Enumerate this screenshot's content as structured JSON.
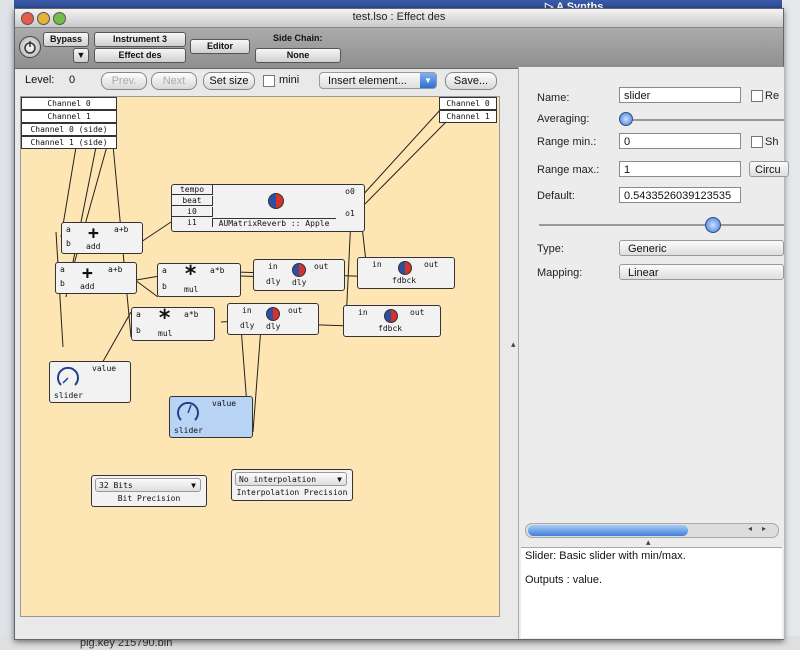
{
  "background": {
    "top_right_menu": "▷ A Synths",
    "bottom_file": "plg.key 215790.bin"
  },
  "window": {
    "title": "test.lso : Effect des"
  },
  "toolbar": {
    "bypass": "Bypass",
    "instrument": "Instrument 3",
    "effect": "Effect des",
    "editor": "Editor",
    "side_chain_label": "Side Chain:",
    "side_chain_value": "None"
  },
  "controls": {
    "level_label": "Level:",
    "level_value": "0",
    "prev": "Prev.",
    "next": "Next",
    "set_size": "Set size",
    "mini": "mini",
    "insert": "Insert element...",
    "save": "Save..."
  },
  "canvas": {
    "in_channels": [
      "Channel 0",
      "Channel 1",
      "Channel 0 (side)",
      "Channel 1 (side)"
    ],
    "out_channels": [
      "Channel 0",
      "Channel 1"
    ],
    "reverb": {
      "ports_in": [
        "tempo",
        "beat",
        "i0",
        "i1"
      ],
      "ports_out": [
        "o0",
        "o1"
      ],
      "name": "AUMatrixReverb :: Apple"
    },
    "add1": {
      "a": "a",
      "b": "b",
      "out": "a+b",
      "name": "add"
    },
    "add2": {
      "a": "a",
      "b": "b",
      "out": "a+b",
      "name": "add"
    },
    "mul1": {
      "a": "a",
      "b": "b",
      "out": "a*b",
      "name": "mul"
    },
    "mul2": {
      "a": "a",
      "b": "b",
      "out": "a*b",
      "name": "mul"
    },
    "dly1": {
      "in": "in",
      "out": "out",
      "dly": "dly",
      "name": "dly"
    },
    "dly2": {
      "in": "in",
      "out": "out",
      "dly": "dly",
      "name": "dly"
    },
    "fdbck1": {
      "in": "in",
      "out": "out",
      "name": "fdbck"
    },
    "fdbck2": {
      "in": "in",
      "out": "out",
      "name": "fdbck"
    },
    "slider1": {
      "out": "value",
      "name": "slider"
    },
    "slider2": {
      "out": "value",
      "name": "slider"
    },
    "bits": {
      "value": "32 Bits",
      "caption": "Bit Precision"
    },
    "interp": {
      "value": "No interpolation",
      "caption": "Interpolation Precision"
    }
  },
  "inspector": {
    "name_label": "Name:",
    "name_value": "slider",
    "re_label": "Re",
    "averaging_label": "Averaging:",
    "range_min_label": "Range min.:",
    "range_min_value": "0",
    "sh_label": "Sh",
    "range_max_label": "Range max.:",
    "range_max_value": "1",
    "circ_label": "Circu",
    "default_label": "Default:",
    "default_value": "0.5433526039123535",
    "default_fraction": 0.5433526039123535,
    "type_label": "Type:",
    "type_value": "Generic",
    "mapping_label": "Mapping:",
    "mapping_value": "Linear",
    "desc_line1": "Slider: Basic slider with min/max.",
    "desc_line2": "Outputs : value."
  }
}
